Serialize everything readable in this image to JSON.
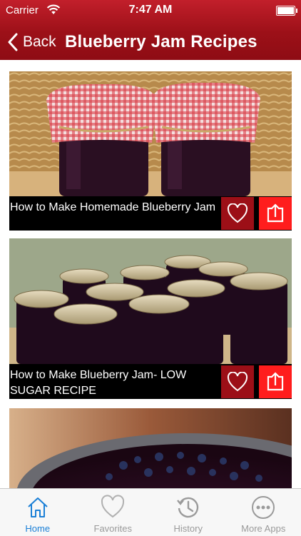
{
  "status": {
    "carrier": "Carrier",
    "time": "7:47 AM"
  },
  "nav": {
    "back_label": "Back",
    "title": "Blueberry Jam Recipes"
  },
  "recipes": [
    {
      "title": "How to Make Homemade Blueberry Jam"
    },
    {
      "title": "How to Make Blueberry Jam- LOW SUGAR RECIPE"
    },
    {
      "title": ""
    }
  ],
  "tabs": [
    {
      "label": "Home",
      "icon": "home-icon",
      "active": true
    },
    {
      "label": "Favorites",
      "icon": "heart-icon",
      "active": false
    },
    {
      "label": "History",
      "icon": "history-icon",
      "active": false
    },
    {
      "label": "More Apps",
      "icon": "more-icon",
      "active": false
    }
  ],
  "colors": {
    "nav_bar": "#9c1018",
    "heart_button": "#9c0f17",
    "share_button": "#ff1d1d",
    "tab_active": "#1a7fd6",
    "tab_inactive": "#9a9a9a"
  }
}
